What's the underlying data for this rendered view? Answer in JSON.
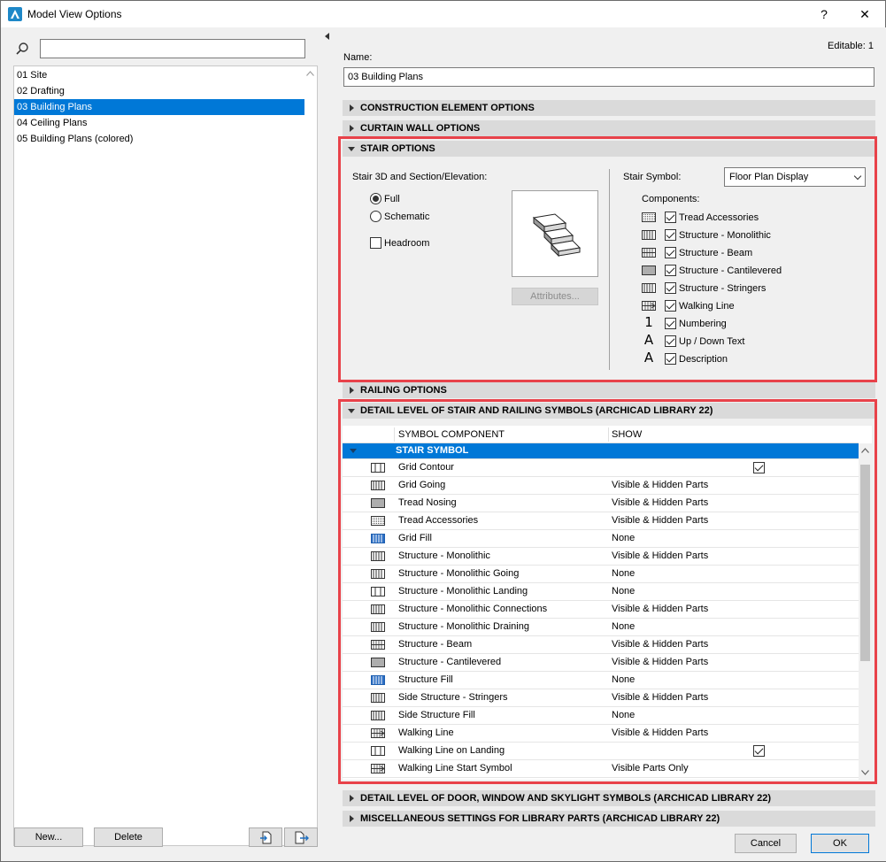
{
  "window": {
    "title": "Model View Options",
    "help": "?",
    "close": "✕"
  },
  "sidebar": {
    "search_placeholder": "",
    "items": [
      {
        "label": "01 Site"
      },
      {
        "label": "02 Drafting"
      },
      {
        "label": "03 Building Plans",
        "selected": true
      },
      {
        "label": "04 Ceiling Plans"
      },
      {
        "label": "05 Building Plans (colored)"
      }
    ],
    "new_label": "New...",
    "delete_label": "Delete"
  },
  "main": {
    "editable": "Editable: 1",
    "name_label": "Name:",
    "name_value": "03 Building Plans",
    "sections": {
      "construction": "CONSTRUCTION ELEMENT OPTIONS",
      "curtain_wall": "CURTAIN WALL OPTIONS",
      "stair": "STAIR OPTIONS",
      "railing": "RAILING OPTIONS",
      "detail_stair": "DETAIL LEVEL OF STAIR AND RAILING SYMBOLS (ARCHICAD LIBRARY 22)",
      "detail_door": "DETAIL LEVEL OF DOOR, WINDOW AND SKYLIGHT SYMBOLS (ARCHICAD LIBRARY 22)",
      "misc": "MISCELLANEOUS SETTINGS FOR LIBRARY PARTS (ARCHICAD LIBRARY 22)"
    },
    "stair_options": {
      "section_label": "Stair 3D and Section/Elevation:",
      "full": "Full",
      "schematic": "Schematic",
      "headroom": "Headroom",
      "attributes": "Attributes...",
      "symbol_label": "Stair Symbol:",
      "symbol_value": "Floor Plan Display",
      "components_label": "Components:",
      "components": [
        {
          "label": "Tread Accessories",
          "icon": "tread-accessories-icon"
        },
        {
          "label": "Structure - Monolithic",
          "icon": "structure-monolithic-icon"
        },
        {
          "label": "Structure - Beam",
          "icon": "structure-beam-icon"
        },
        {
          "label": "Structure - Cantilevered",
          "icon": "structure-cantilevered-icon"
        },
        {
          "label": "Structure - Stringers",
          "icon": "structure-stringers-icon"
        },
        {
          "label": "Walking Line",
          "icon": "walking-line-icon"
        },
        {
          "label": "Numbering",
          "icon": "numbering-icon",
          "glyph": "1"
        },
        {
          "label": "Up / Down Text",
          "icon": "text-icon",
          "glyph": "A"
        },
        {
          "label": "Description",
          "icon": "text-icon",
          "glyph": "A"
        }
      ]
    },
    "table": {
      "col_component": "SYMBOL COMPONENT",
      "col_show": "SHOW",
      "group": "STAIR SYMBOL",
      "rows": [
        {
          "name": "Grid Contour",
          "show": "",
          "check": true,
          "blue": false
        },
        {
          "name": "Grid Going",
          "show": "Visible & Hidden Parts",
          "blue": false
        },
        {
          "name": "Tread Nosing",
          "show": "Visible & Hidden Parts",
          "blue": false
        },
        {
          "name": "Tread Accessories",
          "show": "Visible & Hidden Parts",
          "blue": false
        },
        {
          "name": "Grid Fill",
          "show": "None",
          "blue": true
        },
        {
          "name": "Structure - Monolithic",
          "show": "Visible & Hidden Parts",
          "blue": false
        },
        {
          "name": "Structure - Monolithic Going",
          "show": "None",
          "blue": false
        },
        {
          "name": "Structure - Monolithic Landing",
          "show": "None",
          "blue": false
        },
        {
          "name": "Structure - Monolithic Connections",
          "show": "Visible & Hidden Parts",
          "blue": false
        },
        {
          "name": "Structure - Monolithic Draining",
          "show": "None",
          "blue": false
        },
        {
          "name": "Structure - Beam",
          "show": "Visible & Hidden Parts",
          "blue": false
        },
        {
          "name": "Structure - Cantilevered",
          "show": "Visible & Hidden Parts",
          "blue": false
        },
        {
          "name": "Structure Fill",
          "show": "None",
          "blue": true
        },
        {
          "name": "Side Structure - Stringers",
          "show": "Visible & Hidden Parts",
          "blue": false
        },
        {
          "name": "Side Structure Fill",
          "show": "None",
          "blue": false
        },
        {
          "name": "Walking Line",
          "show": "Visible & Hidden Parts",
          "blue": false
        },
        {
          "name": "Walking Line on Landing",
          "show": "",
          "check": true,
          "blue": false
        },
        {
          "name": "Walking Line Start Symbol",
          "show": "Visible Parts Only",
          "blue": false
        }
      ]
    },
    "cancel_label": "Cancel",
    "ok_label": "OK"
  },
  "colors": {
    "accent": "#0078d7",
    "highlight_box": "#e8424a"
  }
}
